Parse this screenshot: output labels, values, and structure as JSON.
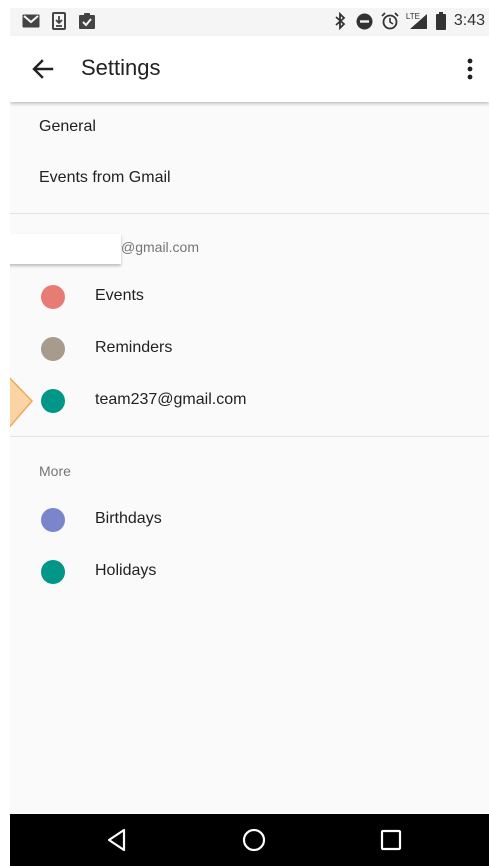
{
  "status_bar": {
    "left_icons": [
      "gmail-icon",
      "download-icon",
      "clipboard-check-icon"
    ],
    "right_icons": [
      "bluetooth-icon",
      "do-not-disturb-icon",
      "alarm-icon",
      "lte-signal-icon",
      "battery-icon"
    ],
    "lte_label": "LTE",
    "time": "3:43"
  },
  "app_bar": {
    "title": "Settings",
    "back_icon": "arrow-back-icon",
    "menu_icon": "more-vert-icon"
  },
  "general_items": [
    {
      "label": "General"
    },
    {
      "label": "Events from Gmail"
    }
  ],
  "account_section": {
    "label": "@gmail.com",
    "calendars": [
      {
        "label": "Events",
        "color": "#e67c73"
      },
      {
        "label": "Reminders",
        "color": "#a79b8e"
      },
      {
        "label": "team237@gmail.com",
        "color": "#009688"
      }
    ]
  },
  "more_section": {
    "label": "More",
    "calendars": [
      {
        "label": "Birthdays",
        "color": "#7986cb"
      },
      {
        "label": "Holidays",
        "color": "#009688"
      }
    ]
  },
  "nav_bar": {
    "icons": [
      "back-triangle-icon",
      "home-circle-icon",
      "recents-square-icon"
    ]
  }
}
